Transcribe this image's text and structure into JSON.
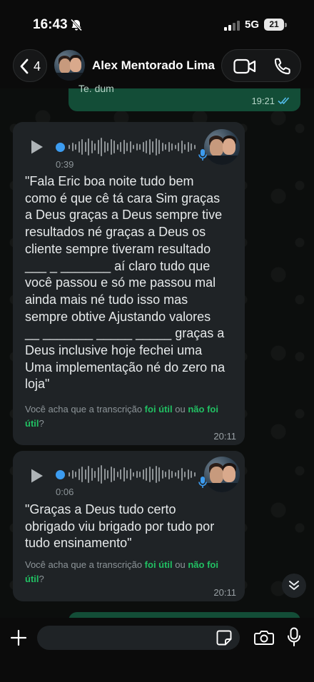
{
  "status_bar": {
    "time": "16:43",
    "network": "5G",
    "battery": "21"
  },
  "header": {
    "back_count": "4",
    "contact_name": "Alex Mentorado Lima"
  },
  "messages": [
    {
      "type": "outgoing",
      "cut_text": "Te. dum",
      "time": "19:21"
    },
    {
      "type": "incoming_voice",
      "duration": "0:39",
      "transcript_lines": [
        "\"Fala Eric boa noite tudo bem",
        "como é que cê tá cara Sim graças",
        "a Deus graças a Deus sempre tive",
        "resultados né graças a Deus os",
        "cliente sempre tiveram resultado",
        "___ _ _______ aí claro tudo que",
        "você passou e só me passou mal",
        "ainda mais né tudo isso mas",
        "sempre obtive Ajustando valores",
        "__ _______ _____ _____ graças a",
        "Deus inclusive hoje fechei uma",
        "Uma implementação né do zero na",
        "loja\""
      ],
      "feedback": {
        "prefix": "Você acha que a transcrição ",
        "yes": "foi útil",
        "middle": " ou ",
        "no": "não foi útil",
        "suffix": "?"
      },
      "time": "20:11"
    },
    {
      "type": "incoming_voice",
      "duration": "0:06",
      "transcript_lines": [
        "\"Graças a Deus tudo certo",
        "obrigado viu brigado por tudo por",
        "tudo ensinamento\""
      ],
      "feedback": {
        "prefix": "Você acha que a transcrição ",
        "yes": "foi útil",
        "middle": " ou ",
        "no": "não foi útil",
        "suffix": "?"
      },
      "time": "20:11"
    }
  ],
  "composer": {
    "placeholder": ""
  },
  "icons": {
    "back": "chevron-left-icon",
    "video": "video-call-icon",
    "phone": "phone-icon",
    "play": "play-icon",
    "mic": "microphone-icon",
    "plus": "plus-icon",
    "sticker": "sticker-icon",
    "camera": "camera-icon",
    "scroll": "double-chevron-down-icon"
  },
  "colors": {
    "accent": "#21c063",
    "outgoing": "#134d37",
    "incoming": "#1f2326",
    "wave_dot": "#3c9cf0"
  }
}
